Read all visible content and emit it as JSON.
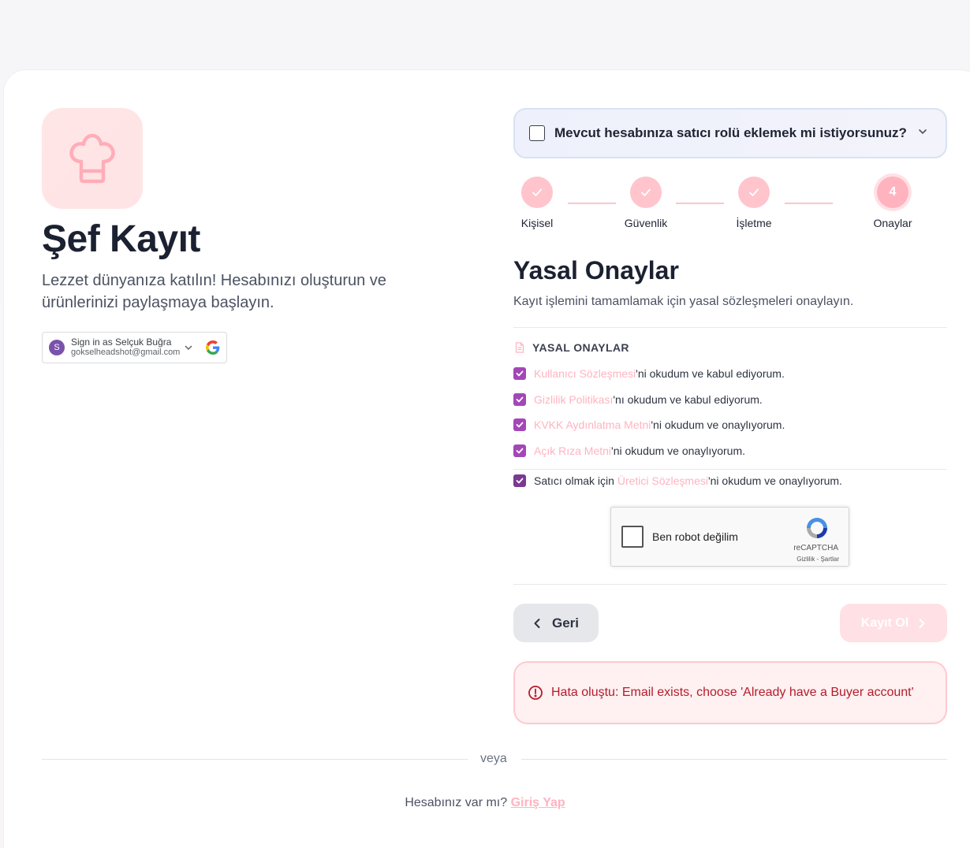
{
  "left": {
    "title": "Şef Kayıt",
    "subtitle": "Lezzet dünyanıza katılın! Hesabınızı oluşturun ve ürünlerinizi paylaşmaya başlayın.",
    "google_signin": {
      "avatar_letter": "S",
      "name": "Sign in as Selçuk Buğra",
      "email": "gokselheadshot@gmail.com"
    }
  },
  "role_toggle": {
    "label": "Mevcut hesabınıza satıcı rolü eklemek mi istiyorsunuz?",
    "checked": false
  },
  "steps": [
    {
      "label": "Kişisel",
      "status": "done"
    },
    {
      "label": "Güvenlik",
      "status": "done"
    },
    {
      "label": "İşletme",
      "status": "done"
    },
    {
      "label": "Onaylar",
      "status": "active",
      "number": "4"
    }
  ],
  "section": {
    "title": "Yasal Onaylar",
    "subtitle": "Kayıt işlemini tamamlamak için yasal sözleşmeleri onaylayın."
  },
  "consents": {
    "group_title": "YASAL ONAYLAR",
    "items": [
      {
        "link": "Kullanıcı Sözleşmesi",
        "rest": "'ni okudum ve kabul ediyorum."
      },
      {
        "link": "Gizlilik Politikası",
        "rest": "'nı okudum ve kabul ediyorum."
      },
      {
        "link": "KVKK Aydınlatma Metni",
        "rest": "'ni okudum ve onaylıyorum."
      },
      {
        "link": "Açık Rıza Metni",
        "rest": "'ni okudum ve onaylıyorum."
      }
    ],
    "seller": {
      "prefix": "Satıcı olmak için ",
      "link": "Üretici Sözleşmesi",
      "rest": "'ni okudum ve onaylıyorum."
    }
  },
  "captcha": {
    "label": "Ben robot değilim",
    "brand": "reCAPTCHA",
    "terms": "Gizlilik - Şartlar"
  },
  "buttons": {
    "back": "Geri",
    "submit": "Kayıt Ol"
  },
  "error": {
    "message": "Hata oluştu: Email exists, choose 'Already have a Buyer account'"
  },
  "divider": "veya",
  "login": {
    "prompt": "Hesabınız var mı?",
    "link": "Giriş Yap"
  },
  "colors": {
    "accent_pink": "#ffb3c0",
    "checkbox_purple": "#a347b8",
    "error_red": "#b31d2b"
  }
}
